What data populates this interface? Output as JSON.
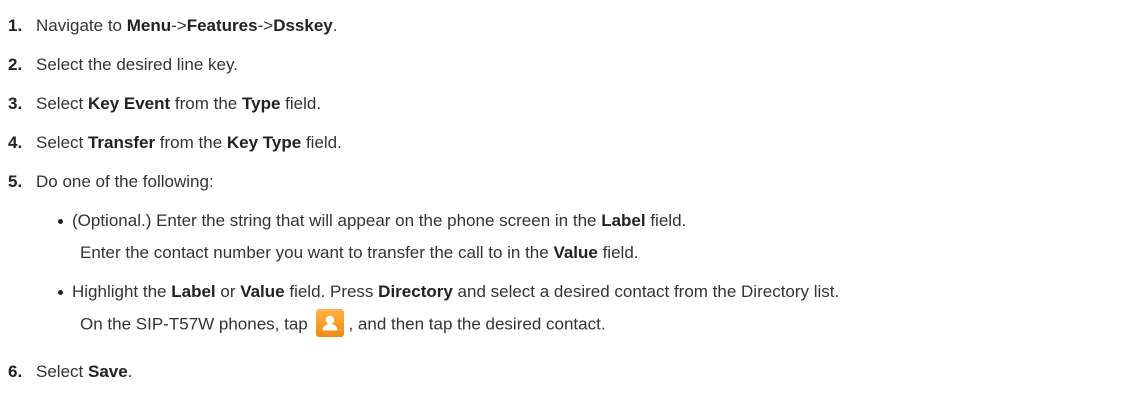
{
  "steps": {
    "s1": {
      "num": "1.",
      "t1": "Navigate to ",
      "b1": "Menu",
      "t2": "->",
      "b2": "Features",
      "t3": "->",
      "b3": "Dsskey",
      "t4": "."
    },
    "s2": {
      "num": "2.",
      "t1": "Select the desired line key."
    },
    "s3": {
      "num": "3.",
      "t1": "Select ",
      "b1": "Key Event",
      "t2": " from the ",
      "b2": "Type",
      "t3": " field."
    },
    "s4": {
      "num": "4.",
      "t1": "Select ",
      "b1": "Transfer",
      "t2": " from the ",
      "b2": "Key Type",
      "t3": " field."
    },
    "s5": {
      "num": "5.",
      "t1": "Do one of the following:"
    },
    "s6": {
      "num": "6.",
      "t1": "Select ",
      "b1": "Save",
      "t2": "."
    }
  },
  "bullets": {
    "b1": {
      "t1": "(Optional.) Enter the string that will appear on the phone screen in the ",
      "b1": "Label",
      "t2": " field.",
      "c1": "Enter the contact number you want to transfer the call to in the ",
      "cb1": "Value",
      "c2": " field."
    },
    "b2": {
      "t1": "Highlight the ",
      "b1": "Label",
      "t2": " or ",
      "b2": "Value",
      "t3": " field. Press ",
      "b3": "Directory",
      "t4": " and select a desired contact from the Directory list.",
      "c1": "On the SIP-T57W phones, tap ",
      "c2": ", and then tap the desired contact.",
      "icon": "contact-icon"
    }
  },
  "colors": {
    "text": "#333333",
    "icon_orange": "#f28a10"
  }
}
